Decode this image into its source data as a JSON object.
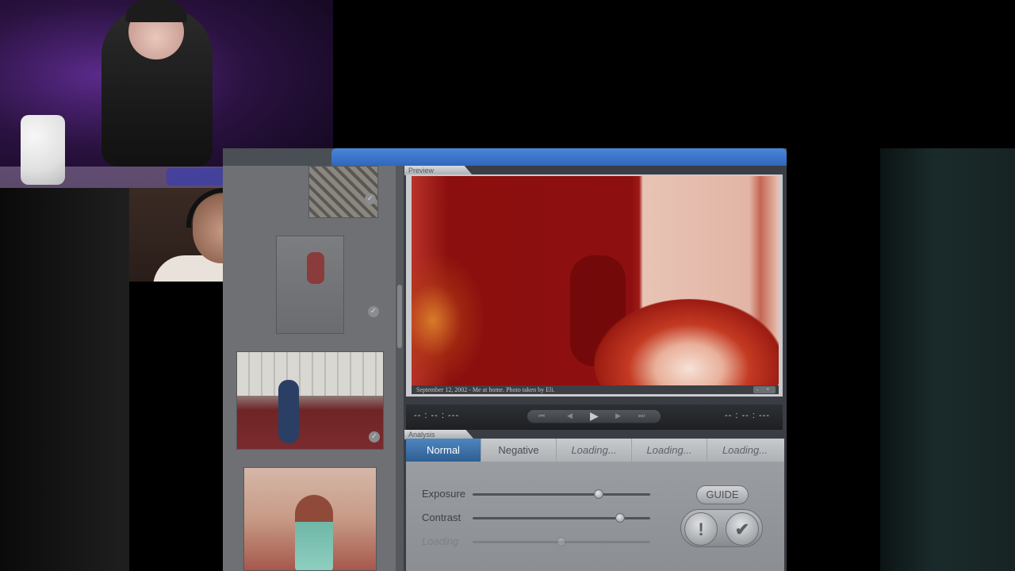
{
  "preview": {
    "tab_label": "Preview",
    "caption": "September 12, 2002 - Me at home. Photo taken by Eli.",
    "zoom_label": "- +"
  },
  "playback": {
    "time_left": "-- : -- : ---",
    "time_right": "-- : -- : ---",
    "buttons": {
      "skip_back": "⏮",
      "step_back": "◀",
      "play": "▶",
      "step_forward": "▶",
      "skip_forward": "⏭"
    }
  },
  "analysis": {
    "tab_label": "Analysis",
    "modes": [
      {
        "label": "Normal",
        "active": true
      },
      {
        "label": "Negative",
        "active": false
      },
      {
        "label": "Loading...",
        "active": false
      },
      {
        "label": "Loading...",
        "active": false
      },
      {
        "label": "Loading...",
        "active": false
      }
    ],
    "sliders": [
      {
        "label": "Exposure",
        "value": 0.72,
        "enabled": true
      },
      {
        "label": "Contrast",
        "value": 0.85,
        "enabled": true
      },
      {
        "label": "Loading",
        "value": 0.5,
        "enabled": false
      }
    ],
    "guide_label": "GUIDE",
    "flag_symbol": "!",
    "approve_symbol": "✔"
  },
  "photo_list": {
    "check_symbol": "✓"
  }
}
